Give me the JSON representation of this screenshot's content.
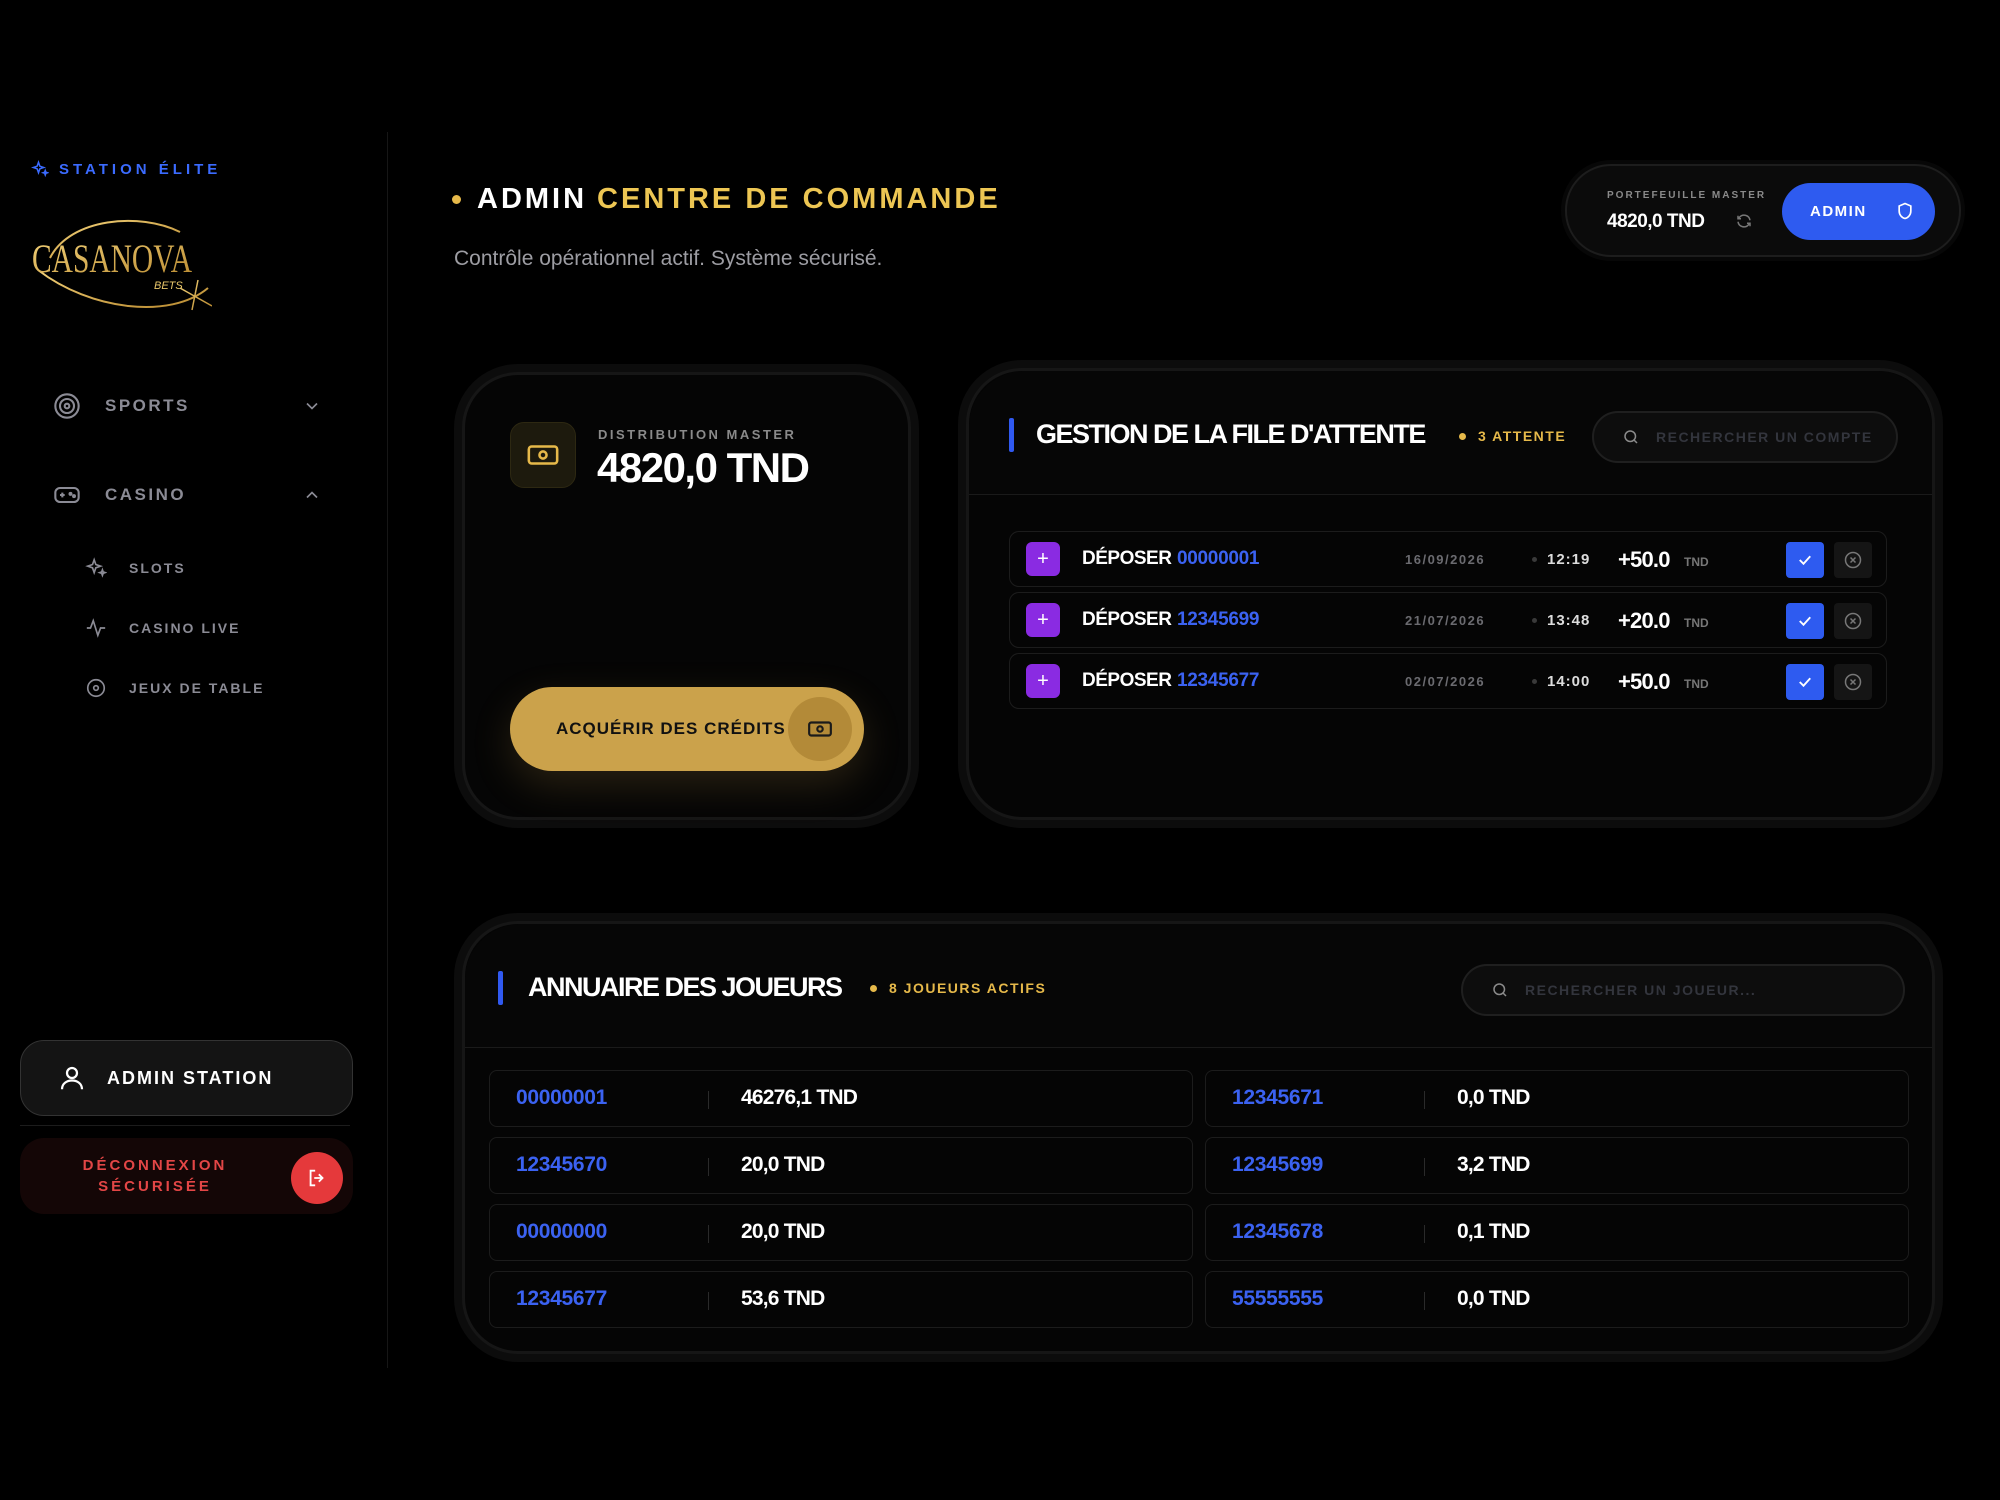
{
  "sidebar": {
    "brand_tag": "STATION ÉLITE",
    "logo_text": "CASANOVA",
    "logo_sub": "BETS",
    "nav": [
      {
        "label": "SPORTS",
        "icon": "target-icon",
        "expanded": false
      },
      {
        "label": "CASINO",
        "icon": "gamepad-icon",
        "expanded": true
      }
    ],
    "casino_items": [
      {
        "label": "SLOTS",
        "icon": "sparkles-icon"
      },
      {
        "label": "CASINO LIVE",
        "icon": "activity-icon"
      },
      {
        "label": "JEUX DE TABLE",
        "icon": "disc-icon"
      }
    ],
    "admin_station": "ADMIN STATION",
    "logout_line1": "DÉCONNEXION",
    "logout_line2": "SÉCURISÉE"
  },
  "header": {
    "title_white": "ADMIN",
    "title_gold": "CENTRE DE COMMANDE",
    "subtitle": "Contrôle opérationnel actif. Système sécurisé.",
    "wallet_label": "PORTEFEUILLE MASTER",
    "wallet_value": "4820,0 TND",
    "admin_button": "ADMIN"
  },
  "distribution": {
    "label": "DISTRIBUTION MASTER",
    "value": "4820,0 TND",
    "button": "ACQUÉRIR DES CRÉDITS"
  },
  "queue": {
    "title": "GESTION DE LA FILE D'ATTENTE",
    "badge": "3 ATTENTE",
    "search_placeholder": "RECHERCHER UN COMPTE",
    "rows": [
      {
        "type": "DÉPOSER",
        "account": "00000001",
        "date": "16/09/2026",
        "time": "12:19",
        "amount": "+50.0",
        "currency": "TND"
      },
      {
        "type": "DÉPOSER",
        "account": "12345699",
        "date": "21/07/2026",
        "time": "13:48",
        "amount": "+20.0",
        "currency": "TND"
      },
      {
        "type": "DÉPOSER",
        "account": "12345677",
        "date": "02/07/2026",
        "time": "14:00",
        "amount": "+50.0",
        "currency": "TND"
      }
    ]
  },
  "players": {
    "title": "ANNUAIRE DES JOUEURS",
    "badge": "8 JOUEURS ACTIFS",
    "search_placeholder": "RECHERCHER UN JOUEUR...",
    "rows": [
      {
        "account": "00000001",
        "balance": "46276,1 TND"
      },
      {
        "account": "12345671",
        "balance": "0,0 TND"
      },
      {
        "account": "12345670",
        "balance": "20,0 TND"
      },
      {
        "account": "12345699",
        "balance": "3,2 TND"
      },
      {
        "account": "00000000",
        "balance": "20,0 TND"
      },
      {
        "account": "12345678",
        "balance": "0,1 TND"
      },
      {
        "account": "12345677",
        "balance": "53,6 TND"
      },
      {
        "account": "55555555",
        "balance": "0,0 TND"
      }
    ]
  },
  "colors": {
    "accent_blue": "#2e5bf0",
    "gold": "#edc653",
    "purple": "#8a2be2",
    "danger": "#e5393b"
  }
}
